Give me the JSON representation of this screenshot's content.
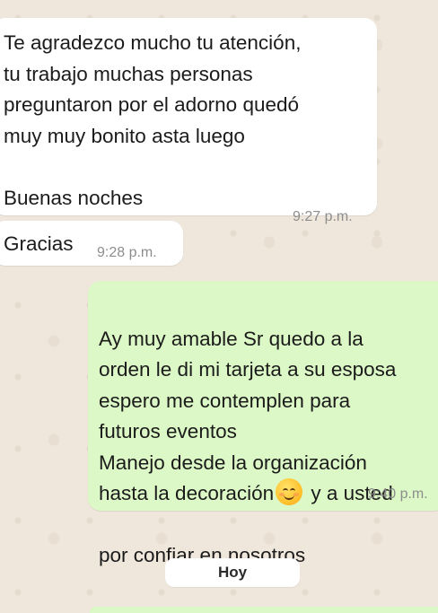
{
  "messages": [
    {
      "direction": "incoming",
      "text": "Te agradezco mucho tu atención,\ntu trabajo muchas personas\npreguntaron por el adorno quedó\nmuy muy bonito asta luego\n\nBuenas noches",
      "time": "9:27 p.m."
    },
    {
      "direction": "incoming",
      "text": "Gracias",
      "time": "9:28 p.m."
    },
    {
      "direction": "outgoing",
      "lines_before_emoji": "Ay muy amable Sr quedo a la\norden le di mi tarjeta a su esposa\nespero me contemplen para\nfuturos eventos\nManejo desde la organización\nhasta la decoración",
      "emoji": "smiling-face-icon",
      "after_emoji": "y a usted",
      "last_line": "por confiar en nosotros",
      "time": "9:40 p.m."
    }
  ],
  "date_divider": "Hoy",
  "colors": {
    "wallpaper": "#efe7dc",
    "incoming_bubble": "#ffffff",
    "outgoing_bubble": "#dcf8c6",
    "timestamp": "#8d8d8d"
  }
}
